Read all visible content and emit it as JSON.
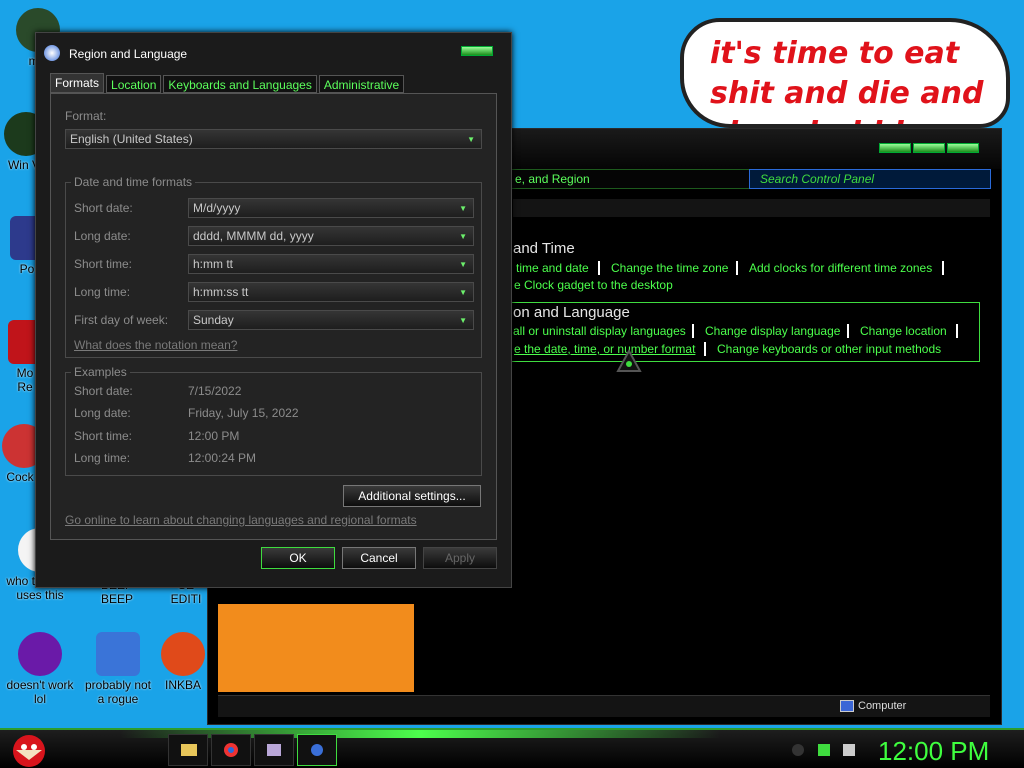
{
  "desktop": {
    "icons": [
      {
        "label": "mis",
        "color": "#2a4a2a"
      },
      {
        "label": "Win V",
        "color": "#1c3a1c"
      },
      {
        "label": "Po",
        "color": "#2d3a8c"
      },
      {
        "label": "Mo Re",
        "color": "#c0141a"
      },
      {
        "label": "Cock",
        "color": "#c33"
      },
      {
        "label": "who the fuck uses this",
        "color": "#f4f4f4"
      },
      {
        "label": "BEEP BEEP",
        "color": "#d9d9d9"
      },
      {
        "label": "SE EDITI",
        "color": "#d9d9d9"
      },
      {
        "label": "doesn't work lol",
        "color": "#6a1aa8"
      },
      {
        "label": "probably not a rogue",
        "color": "#3a74d8"
      },
      {
        "label": "INKBA",
        "color": "#e04a1a"
      }
    ]
  },
  "speech_bubble": {
    "text": "it's time to eat shit and die and chew bubble gum"
  },
  "control_panel": {
    "address_text": "e, and Region",
    "search_placeholder": "Search Control Panel",
    "section1_heading": "and Time",
    "section1_links": [
      "time and date",
      "Change the time zone",
      "Add clocks for different time zones",
      "e Clock gadget to the desktop"
    ],
    "section2_heading": "on and Language",
    "section2_links": [
      "all or uninstall display languages",
      "Change display language",
      "Change location",
      "e the date, time, or number format",
      "Change keyboards or other input methods"
    ],
    "status_text": "Computer"
  },
  "dialog": {
    "title": "Region and Language",
    "tabs": [
      "Formats",
      "Location",
      "Keyboards and Languages",
      "Administrative"
    ],
    "format_label": "Format:",
    "format_value": "English (United States)",
    "datetime_group": "Date and time formats",
    "fields": [
      {
        "label": "Short date:",
        "value": "M/d/yyyy"
      },
      {
        "label": "Long date:",
        "value": "dddd, MMMM dd, yyyy"
      },
      {
        "label": "Short time:",
        "value": "h:mm tt"
      },
      {
        "label": "Long time:",
        "value": "h:mm:ss tt"
      },
      {
        "label": "First day of week:",
        "value": "Sunday"
      }
    ],
    "notation_link": "What does the notation mean?",
    "examples_group": "Examples",
    "examples": [
      {
        "label": "Short date:",
        "value": "7/15/2022"
      },
      {
        "label": "Long date:",
        "value": "Friday, July 15, 2022"
      },
      {
        "label": "Short time:",
        "value": "12:00 PM"
      },
      {
        "label": "Long time:",
        "value": "12:00:24 PM"
      }
    ],
    "additional_settings": "Additional settings...",
    "online_link": "Go online to learn about changing languages and regional formats",
    "ok": "OK",
    "cancel": "Cancel",
    "apply": "Apply"
  },
  "taskbar": {
    "clock": "12:00 PM"
  }
}
